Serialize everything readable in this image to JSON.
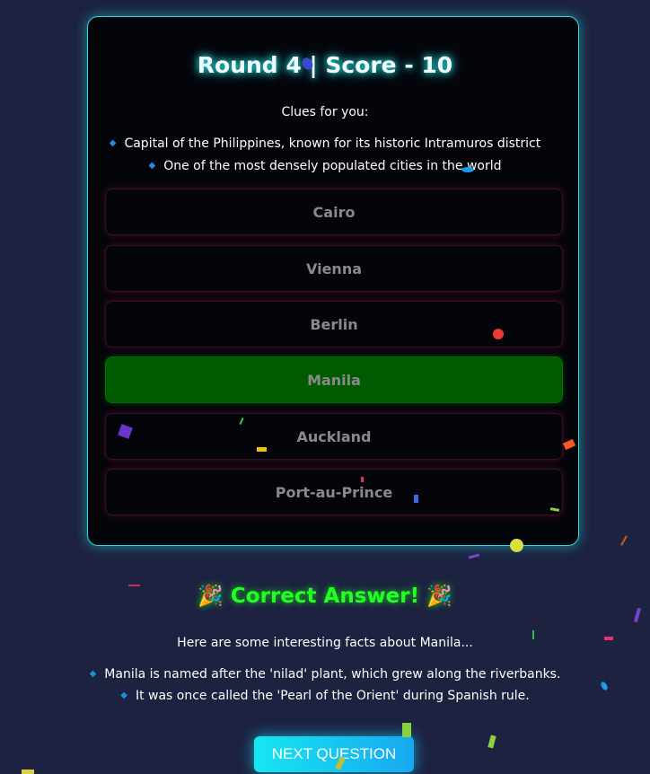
{
  "quiz": {
    "title": "Round 4 | Score - 10",
    "clues_heading": "Clues for you:",
    "clues": [
      "Capital of the Philippines, known for its historic Intramuros district",
      "One of the most densely populated cities in the world"
    ],
    "options": [
      "Cairo",
      "Vienna",
      "Berlin",
      "Manila",
      "Auckland",
      "Port-au-Prince"
    ],
    "selected_correct": "Manila"
  },
  "result": {
    "heading": "🎉 Correct Answer! 🎉",
    "facts_heading": "Here are some interesting facts about Manila...",
    "facts": [
      "Manila is named after the 'nilad' plant, which grew along the riverbanks.",
      "It was once called the 'Pearl of the Orient' during Spanish rule."
    ]
  },
  "next_button": "NEXT QUESTION",
  "colors": {
    "background": "#1c2240",
    "card_border": "#26e0e0",
    "correct_option": "#005a00",
    "result_text": "#22ff22",
    "next_button": "#16e6f0"
  }
}
